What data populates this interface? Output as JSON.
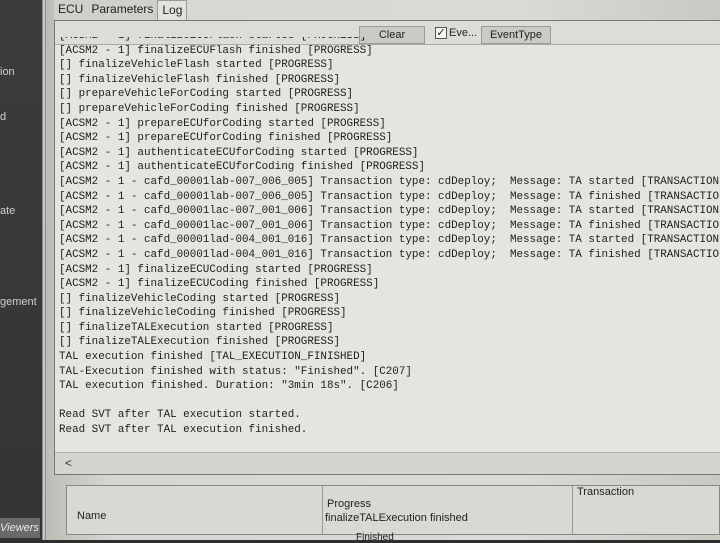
{
  "sidebar": {
    "items": [
      "ion",
      "d",
      "ate",
      "gement"
    ],
    "viewers": "Viewers"
  },
  "tabs": [
    "ECU",
    "Parameters",
    "Log"
  ],
  "toolbar": {
    "clear": "Clear",
    "event_checkbox": "Eve...",
    "event_checked": true,
    "event_type": "EventType"
  },
  "log": [
    "[ACSM2 - 1] finalizeECUFlash started [PROGRESS]",
    "[ACSM2 - 1] finalizeECUFlash finished [PROGRESS]",
    "[] finalizeVehicleFlash started [PROGRESS]",
    "[] finalizeVehicleFlash finished [PROGRESS]",
    "[] prepareVehicleForCoding started [PROGRESS]",
    "[] prepareVehicleForCoding finished [PROGRESS]",
    "[ACSM2 - 1] prepareECUforCoding started [PROGRESS]",
    "[ACSM2 - 1] prepareECUforCoding finished [PROGRESS]",
    "[ACSM2 - 1] authenticateECUforCoding started [PROGRESS]",
    "[ACSM2 - 1] authenticateECUforCoding finished [PROGRESS]",
    "[ACSM2 - 1 - cafd_00001lab-007_006_005] Transaction type: cdDeploy;  Message: TA started [TRANSACTION]",
    "[ACSM2 - 1 - cafd_00001lab-007_006_005] Transaction type: cdDeploy;  Message: TA finished [TRANSACTION]",
    "[ACSM2 - 1 - cafd_00001lac-007_001_006] Transaction type: cdDeploy;  Message: TA started [TRANSACTION]",
    "[ACSM2 - 1 - cafd_00001lac-007_001_006] Transaction type: cdDeploy;  Message: TA finished [TRANSACTION]",
    "[ACSM2 - 1 - cafd_00001lad-004_001_016] Transaction type: cdDeploy;  Message: TA started [TRANSACTION]",
    "[ACSM2 - 1 - cafd_00001lad-004_001_016] Transaction type: cdDeploy;  Message: TA finished [TRANSACTION]",
    "[ACSM2 - 1] finalizeECUCoding started [PROGRESS]",
    "[ACSM2 - 1] finalizeECUCoding finished [PROGRESS]",
    "[] finalizeVehicleCoding started [PROGRESS]",
    "[] finalizeVehicleCoding finished [PROGRESS]",
    "[] finalizeTALExecution started [PROGRESS]",
    "[] finalizeTALExecution finished [PROGRESS]",
    "TAL execution finished [TAL_EXECUTION_FINISHED]",
    "TAL-Execution finished with status: \"Finished\". [C207]",
    "TAL execution finished. Duration: \"3min 18s\". [C206]",
    "",
    "Read SVT after TAL execution started.",
    "Read SVT after TAL execution finished."
  ],
  "scroll_left": "<",
  "status": {
    "name_label": "Name",
    "progress_label": "Progress",
    "progress_value": "finalizeTALExecution finished",
    "transaction_label": "Transaction",
    "state": "Finished"
  }
}
